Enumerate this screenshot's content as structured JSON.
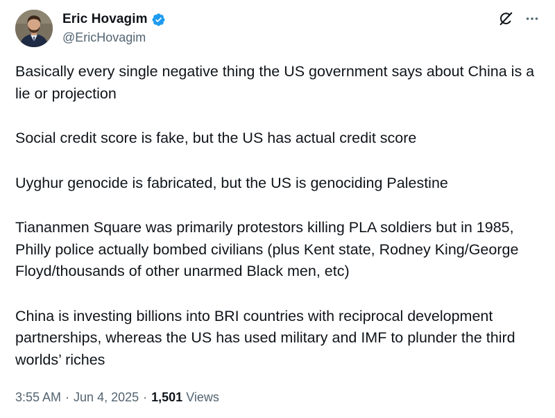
{
  "author": {
    "display_name": "Eric Hovagim",
    "handle": "@EricHovagim",
    "verified": true
  },
  "icons": {
    "verified": "verified-badge-icon",
    "grok": "grok-icon",
    "more": "more-options-icon"
  },
  "colors": {
    "verified_blue": "#1d9bf0",
    "text_primary": "#0f1419",
    "text_secondary": "#536471"
  },
  "tweet": {
    "paragraphs": [
      "Basically every single negative thing the US government says about China is a lie or projection",
      "Social credit score is fake, but the US has actual credit score",
      "Uyghur genocide is fabricated, but the US is genociding Palestine",
      "Tiananmen Square was primarily protestors killing PLA soldiers but in 1985, Philly police actually bombed civilians (plus Kent state, Rodney King/George Floyd/thousands of other unarmed Black men, etc)",
      "China is investing billions into BRI countries with reciprocal development partnerships, whereas the US has used military and IMF to plunder the third worlds’ riches"
    ]
  },
  "meta": {
    "time": "3:55 AM",
    "date": "Jun 4, 2025",
    "separator": "·",
    "views_count": "1,501",
    "views_label": "Views"
  }
}
